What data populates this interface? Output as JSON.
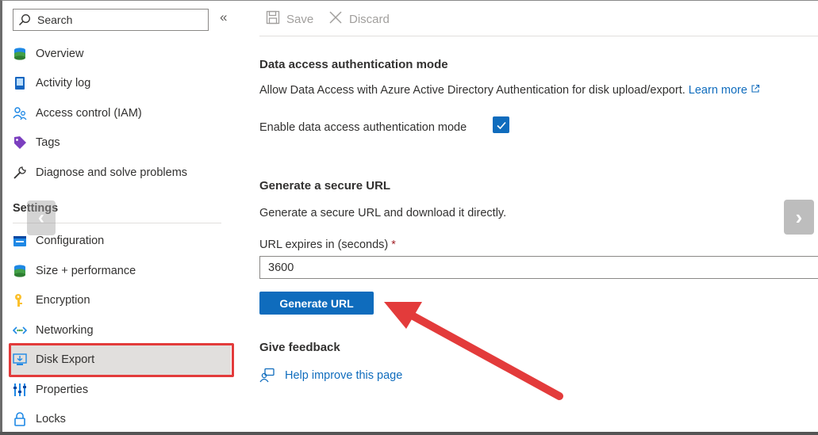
{
  "search": {
    "placeholder": "Search"
  },
  "sidebar": {
    "collapse_glyph": "«",
    "items": [
      {
        "label": "Overview",
        "icon": "overview-icon"
      },
      {
        "label": "Activity log",
        "icon": "activity-log-icon"
      },
      {
        "label": "Access control (IAM)",
        "icon": "access-control-icon"
      },
      {
        "label": "Tags",
        "icon": "tag-icon"
      },
      {
        "label": "Diagnose and solve problems",
        "icon": "wrench-icon"
      }
    ],
    "section_label": "Settings",
    "settings_items": [
      {
        "label": "Configuration",
        "icon": "configuration-icon"
      },
      {
        "label": "Size + performance",
        "icon": "size-performance-icon"
      },
      {
        "label": "Encryption",
        "icon": "key-icon"
      },
      {
        "label": "Networking",
        "icon": "networking-icon"
      },
      {
        "label": "Disk Export",
        "icon": "disk-export-icon",
        "selected": true
      },
      {
        "label": "Properties",
        "icon": "properties-icon"
      },
      {
        "label": "Locks",
        "icon": "lock-icon"
      }
    ]
  },
  "toolbar": {
    "save_label": "Save",
    "discard_label": "Discard"
  },
  "main": {
    "auth_title": "Data access authentication mode",
    "auth_description": "Allow Data Access with Azure Active Directory Authentication for disk upload/export.",
    "learn_more": "Learn more",
    "enable_label": "Enable data access authentication mode",
    "enable_checked": true,
    "url_title": "Generate a secure URL",
    "url_description": "Generate a secure URL and download it directly.",
    "expires_label": "URL expires in (seconds)",
    "required_mark": "*",
    "expires_value": "3600",
    "generate_button": "Generate URL",
    "feedback_title": "Give feedback",
    "feedback_link": "Help improve this page"
  },
  "colors": {
    "accent": "#0f6cbd",
    "annotation_red": "#e33b3b",
    "selected_bg": "#e1dfdd"
  }
}
